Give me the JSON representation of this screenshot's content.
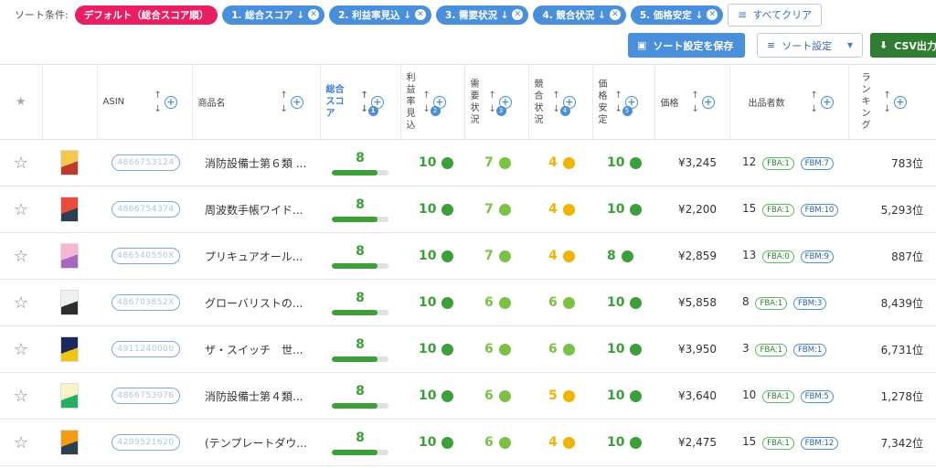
{
  "sortbar": {
    "label": "ソート条件:",
    "default_chip": "デフォルト（総合スコア順）",
    "chips": [
      "1. 総合スコア ↓",
      "2. 利益率見込 ↓",
      "3. 需要状況 ↓",
      "4. 競合状況 ↓",
      "5. 価格安定 ↓"
    ],
    "clear_label": "すべてクリア"
  },
  "toolbar": {
    "save_label": "ソート設定を保存",
    "sort_label": "ソート設定",
    "csv_label": "CSV出力"
  },
  "columns": {
    "asin": "ASIN",
    "name": "商品名",
    "total": "総合スコア",
    "profit": "利益率見込",
    "demand": "需要状況",
    "competition": "競合状況",
    "stability": "価格安定",
    "price": "価格",
    "sellers": "出品者数",
    "ranking": "ランキング"
  },
  "sort_badges": [
    "1",
    "2",
    "3",
    "4",
    "5"
  ],
  "colors": {
    "high": "#3aa037",
    "mid": "#7cc242",
    "low": "#f0b400",
    "accent": "#4a8fdb",
    "default_chip": "#e91e63",
    "csv": "#2e7d32"
  },
  "rows": [
    {
      "asin": "4866753124",
      "name": "消防設備士第６類 ...",
      "total": "8",
      "total_fraction": 0.8,
      "profit": "10",
      "profit_level": "high",
      "demand": "7",
      "demand_level": "mid",
      "competition": "4",
      "competition_level": "low",
      "stability": "10",
      "stability_level": "high",
      "price": "¥3,245",
      "sellers": "12",
      "fba": "FBA:1",
      "fbm": "FBM:7",
      "rank": "783位",
      "thumb": [
        "#f2c94c",
        "#c0392b"
      ]
    },
    {
      "asin": "4866754374",
      "name": "周波数手帳ワイド...",
      "total": "8",
      "total_fraction": 0.8,
      "profit": "10",
      "profit_level": "high",
      "demand": "7",
      "demand_level": "mid",
      "competition": "4",
      "competition_level": "low",
      "stability": "10",
      "stability_level": "high",
      "price": "¥2,200",
      "sellers": "15",
      "fba": "FBA:1",
      "fbm": "FBM:10",
      "rank": "5,293位",
      "thumb": [
        "#e74c3c",
        "#2c3e50"
      ]
    },
    {
      "asin": "486540550X",
      "name": "プリキュアオール...",
      "total": "8",
      "total_fraction": 0.8,
      "profit": "10",
      "profit_level": "high",
      "demand": "7",
      "demand_level": "mid",
      "competition": "4",
      "competition_level": "low",
      "stability": "8",
      "stability_level": "high",
      "price": "¥2,859",
      "sellers": "13",
      "fba": "FBA:0",
      "fbm": "FBM:9",
      "rank": "887位",
      "thumb": [
        "#f5b7d2",
        "#a569bd"
      ]
    },
    {
      "asin": "486703852X",
      "name": "グローバリストの...",
      "total": "8",
      "total_fraction": 0.8,
      "profit": "10",
      "profit_level": "high",
      "demand": "6",
      "demand_level": "mid",
      "competition": "6",
      "competition_level": "mid",
      "stability": "10",
      "stability_level": "high",
      "price": "¥5,858",
      "sellers": "8",
      "fba": "FBA:1",
      "fbm": "FBM:3",
      "rank": "8,439位",
      "thumb": [
        "#ecf0f1",
        "#2d2d2d"
      ]
    },
    {
      "asin": "4911240000",
      "name": "ザ・スイッチ　世...",
      "total": "8",
      "total_fraction": 0.8,
      "profit": "10",
      "profit_level": "high",
      "demand": "6",
      "demand_level": "mid",
      "competition": "6",
      "competition_level": "mid",
      "stability": "10",
      "stability_level": "high",
      "price": "¥3,950",
      "sellers": "3",
      "fba": "FBA:1",
      "fbm": "FBM:1",
      "rank": "6,731位",
      "thumb": [
        "#1a2a5a",
        "#f1c40f"
      ]
    },
    {
      "asin": "4866753076",
      "name": "消防設備士第４類...",
      "total": "8",
      "total_fraction": 0.8,
      "profit": "10",
      "profit_level": "high",
      "demand": "6",
      "demand_level": "mid",
      "competition": "5",
      "competition_level": "low",
      "stability": "10",
      "stability_level": "high",
      "price": "¥3,640",
      "sellers": "10",
      "fba": "FBA:1",
      "fbm": "FBM:5",
      "rank": "1,278位",
      "thumb": [
        "#f7f3c6",
        "#27ae60"
      ]
    },
    {
      "asin": "4299521620",
      "name": "(テンプレートダウ...",
      "total": "8",
      "total_fraction": 0.8,
      "profit": "10",
      "profit_level": "high",
      "demand": "6",
      "demand_level": "mid",
      "competition": "4",
      "competition_level": "low",
      "stability": "10",
      "stability_level": "high",
      "price": "¥2,475",
      "sellers": "15",
      "fba": "FBA:1",
      "fbm": "FBM:12",
      "rank": "7,342位",
      "thumb": [
        "#f39c12",
        "#2c3e50"
      ]
    }
  ]
}
